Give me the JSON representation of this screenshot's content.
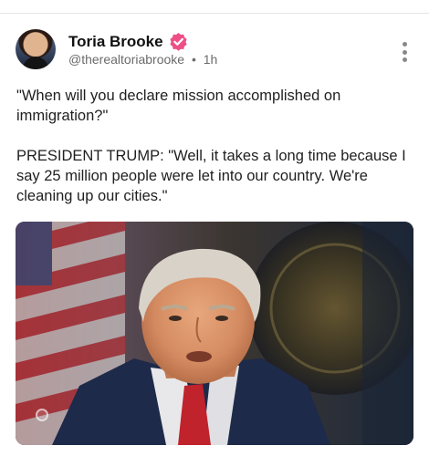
{
  "post": {
    "author_name": "Toria Brooke",
    "handle": "@therealtoriabrooke",
    "separator": "•",
    "time": "1h",
    "text_paragraphs": [
      "\"When will you declare mission accomplished on immigration?\"",
      "PRESIDENT TRUMP: \"Well, it takes a long time because I say 25 million people were let into our country. We're cleaning up our cities.\""
    ]
  },
  "icons": {
    "verified": "verified-badge-icon",
    "more": "more-vertical-icon"
  },
  "colors": {
    "verified_badge": "#ee4f86",
    "handle_text": "#6b6b6b"
  }
}
